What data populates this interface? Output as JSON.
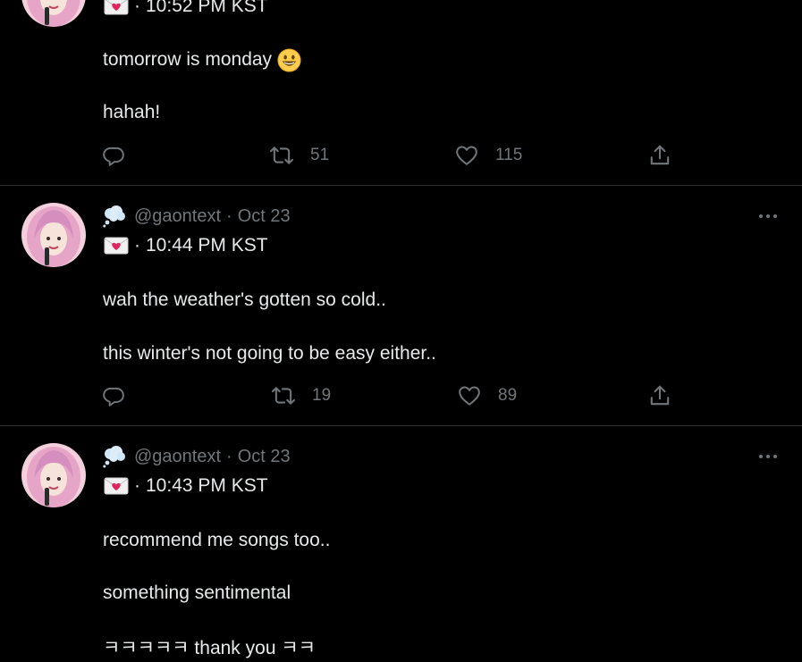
{
  "tweets": [
    {
      "time": "10:52 PM KST",
      "lines": [
        "tomorrow is monday",
        "hahah!"
      ],
      "replies": "",
      "retweets": "51",
      "likes": "115"
    },
    {
      "handle": "@gaontext",
      "date": "Oct 23",
      "time": "10:44 PM KST",
      "lines": [
        "wah the weather's gotten so cold..",
        "this winter's not going to be easy either.."
      ],
      "replies": "",
      "retweets": "19",
      "likes": "89"
    },
    {
      "handle": "@gaontext",
      "date": "Oct 23",
      "time": "10:43 PM KST",
      "lines": [
        "recommend me songs too..",
        "something sentimental",
        "ㅋㅋㅋㅋㅋ thank you ㅋㅋ"
      ]
    }
  ],
  "separator": "·",
  "icons": {
    "name_emoji": "thought-balloon-icon",
    "envelope": "love-letter-icon",
    "smiley": "grinning-face-icon",
    "reply": "reply-icon",
    "retweet": "retweet-icon",
    "like": "heart-icon",
    "share": "share-icon",
    "more": "more-icon"
  },
  "colors": {
    "background": "#000000",
    "text": "#e7e9ea",
    "muted": "#71767b",
    "divider": "#2f3336",
    "avatar_bg": "#f4cfdc"
  }
}
